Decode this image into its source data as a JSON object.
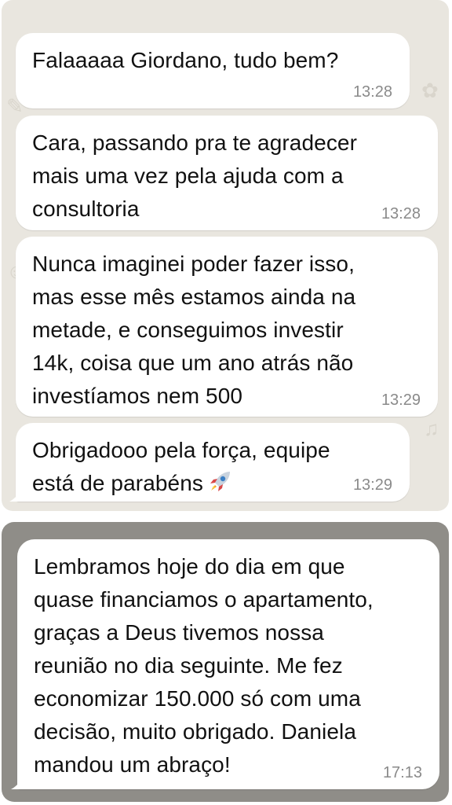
{
  "chat_top": {
    "messages": [
      {
        "text": "Falaaaaa Giordano, tudo bem?",
        "time": "13:28"
      },
      {
        "text": "Cara, passando pra te agradecer\nmais uma vez pela ajuda com a\nconsultoria",
        "time": "13:28"
      },
      {
        "text": "Nunca imaginei poder fazer isso,\nmas esse mês estamos ainda na\nmetade, e conseguimos investir\n14k, coisa que um ano atrás não\ninvestíamos nem 500",
        "time": "13:29"
      },
      {
        "text": "Obrigadooo pela força, equipe\nestá de parabéns",
        "emoji": "rocket-emoji",
        "time": "13:29"
      }
    ]
  },
  "chat_bottom": {
    "messages": [
      {
        "text": "Lembramos hoje do dia em que\nquase financiamos o apartamento,\ngraças a Deus tivemos nossa\nreunião no dia seguinte. Me fez\neconomizar 150.000 só com uma\ndecisão, muito obrigado. Daniela\nmandou um abraço!",
        "time": "17:13"
      }
    ]
  },
  "colors": {
    "chat_wallpaper": "#e9e6df",
    "bottom_wallpaper": "#8f8d88",
    "bubble": "#ffffff",
    "timestamp": "#8a8a8a"
  }
}
